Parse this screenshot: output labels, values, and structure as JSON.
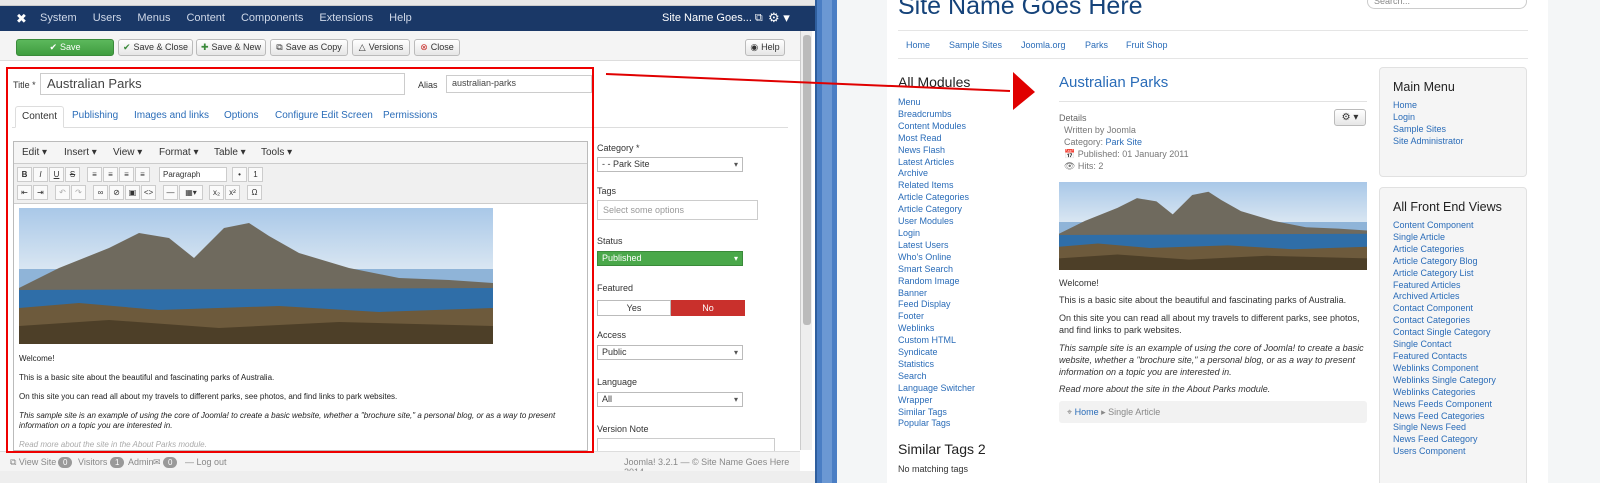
{
  "admin": {
    "nav": {
      "logo": "✖",
      "items": [
        "System",
        "Users",
        "Menus",
        "Content",
        "Components",
        "Extensions",
        "Help"
      ],
      "site_name": "Site Name Goes... ⧉",
      "gear": "⚙ ▾"
    },
    "toolbar": {
      "save": "Save",
      "save_close": "Save & Close",
      "save_new": "Save & New",
      "save_copy": "Save as Copy",
      "versions": "Versions",
      "close": "Close",
      "help": "Help"
    },
    "form": {
      "title_label": "Title *",
      "title_value": "Australian Parks",
      "alias_label": "Alias",
      "alias_value": "australian-parks"
    },
    "tabs": [
      "Content",
      "Publishing",
      "Images and links",
      "Options",
      "Configure Edit Screen",
      "Permissions"
    ],
    "editor": {
      "menu": [
        "Edit ▾",
        "Insert ▾",
        "View ▾",
        "Format ▾",
        "Table ▾",
        "Tools ▾"
      ],
      "format_select": "Paragraph",
      "paragraphs": [
        "Welcome!",
        "This is a basic site about the beautiful and fascinating parks of Australia.",
        "On this site you can read all about my travels to different parks, see photos, and find links to park websites.",
        "This sample site is an example of using the core of Joomla! to create a basic website, whether a \"brochure site,\" a personal blog, or as a way to present information on a topic you are interested in.",
        "Read more about the site in the About Parks module."
      ]
    },
    "side": {
      "category_label": "Category *",
      "category_value": "- - Park Site",
      "tags_label": "Tags",
      "tags_placeholder": "Select some options",
      "status_label": "Status",
      "status_value": "Published",
      "featured_label": "Featured",
      "featured_yes": "Yes",
      "featured_no": "No",
      "access_label": "Access",
      "access_value": "Public",
      "language_label": "Language",
      "language_value": "All",
      "version_label": "Version Note"
    },
    "status": {
      "view_site": "⧉ View Site",
      "visitors_count": "0",
      "visitors": "Visitors",
      "admin_count": "1",
      "admin": "Admin",
      "msg_icon": "✉",
      "msg_count": "0",
      "logout": "— Log out",
      "footer": "Joomla! 3.2.1 — © Site Name Goes Here 2014"
    }
  },
  "site": {
    "title": "Site Name Goes Here",
    "search_placeholder": "Search...",
    "nav": [
      "Home",
      "Sample Sites",
      "Joomla.org",
      "Parks",
      "Fruit Shop"
    ],
    "all_modules": {
      "title": "All Modules",
      "items": [
        "Menu",
        "Breadcrumbs",
        "Content Modules",
        "Most Read",
        "News Flash",
        "Latest Articles",
        "Archive",
        "Related Items",
        "Article Categories",
        "Article Category",
        "User Modules",
        "Login",
        "Latest Users",
        "Who's Online",
        "Smart Search",
        "Random Image",
        "Banner",
        "Feed Display",
        "Footer",
        "Weblinks",
        "Custom HTML",
        "Syndicate",
        "Statistics",
        "Search",
        "Language Switcher",
        "Wrapper",
        "Similar Tags",
        "Popular Tags"
      ]
    },
    "similar_tags": {
      "title": "Similar Tags 2",
      "none": "No matching tags"
    },
    "article": {
      "title": "Australian Parks",
      "details": "Details",
      "gear": "⚙ ▾",
      "written_by": "Written by Joomla",
      "category_prefix": "Category:",
      "category_link": "Park Site",
      "published": "📅 Published: 01 January 2011",
      "hits": "👁 Hits: 2",
      "p1": "Welcome!",
      "p2": "This is a basic site about the beautiful and fascinating parks of Australia.",
      "p3": "On this site you can read all about my travels to different parks, see photos, and find links to park websites.",
      "p4": "This sample site is an example of using the core of Joomla! to create a basic website, whether a \"brochure site,\" a personal blog, or as a way to present information on a topic you are interested in.",
      "p5": "Read more about the site in the About Parks module."
    },
    "breadcrumbs": {
      "pin": "⌖",
      "home": "Home",
      "sep": "▸",
      "current": "Single Article"
    },
    "main_menu": {
      "title": "Main Menu",
      "items": [
        "Home",
        "Login",
        "Sample Sites",
        "Site Administrator"
      ]
    },
    "front_views": {
      "title": "All Front End Views",
      "items": [
        "Content Component",
        "Single Article",
        "Article Categories",
        "Article Category Blog",
        "Article Category List",
        "Featured Articles",
        "Archived Articles",
        "Contact Component",
        "Contact Categories",
        "Contact Single Category",
        "Single Contact",
        "Featured Contacts",
        "Weblinks Component",
        "Weblinks Single Category",
        "Weblinks Categories",
        "News Feeds Component",
        "News Feed Categories",
        "Single News Feed",
        "News Feed Category",
        "Users Component"
      ]
    }
  },
  "colors": {
    "admin_nav": "#1a3867",
    "link": "#2a6cb8",
    "annotation": "#e00000",
    "save_green": "#4aa84a",
    "no_red": "#c9302c"
  }
}
